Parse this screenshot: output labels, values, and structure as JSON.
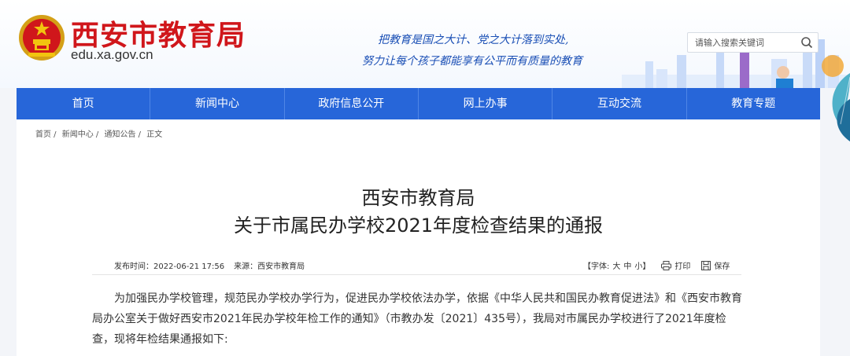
{
  "header": {
    "site_title": "西安市教育局",
    "site_domain": "edu.xa.gov.cn",
    "slogan_line1": "把教育是国之大计、党之大计落到实处,",
    "slogan_line2": "努力让每个孩子都能享有公平而有质量的教育",
    "search": {
      "placeholder": "请输入搜索关键词"
    }
  },
  "nav": {
    "items": [
      "首页",
      "新闻中心",
      "政府信息公开",
      "网上办事",
      "互动交流",
      "教育专题"
    ]
  },
  "breadcrumb": [
    "首页 /",
    "新闻中心 /",
    "通知公告 /",
    "正文"
  ],
  "article": {
    "title_line1": "西安市教育局",
    "title_line2": "关于市属民办学校2021年度检查结果的通报",
    "publish_time": "发布时间：2022-06-21 17:56",
    "source": "来源：西安市教育局",
    "font_size_label": "【字体:",
    "font_sizes": [
      "大",
      "中",
      "小】"
    ],
    "print_label": "打印",
    "save_label": "保存",
    "body": "为加强民办学校管理，规范民办学校办学行为，促进民办学校依法办学，依据《中华人民共和国民办教育促进法》和《西安市教育局办公室关于做好西安市2021年民办学校年检工作的通知》（市教办发〔2021〕435号），我局对市属民办学校进行了2021年度检查，现将年检结果通报如下:"
  },
  "colors": {
    "brand_red": "#d0161b",
    "nav_blue": "#2766d9",
    "slogan_blue": "#1a4fb5"
  }
}
